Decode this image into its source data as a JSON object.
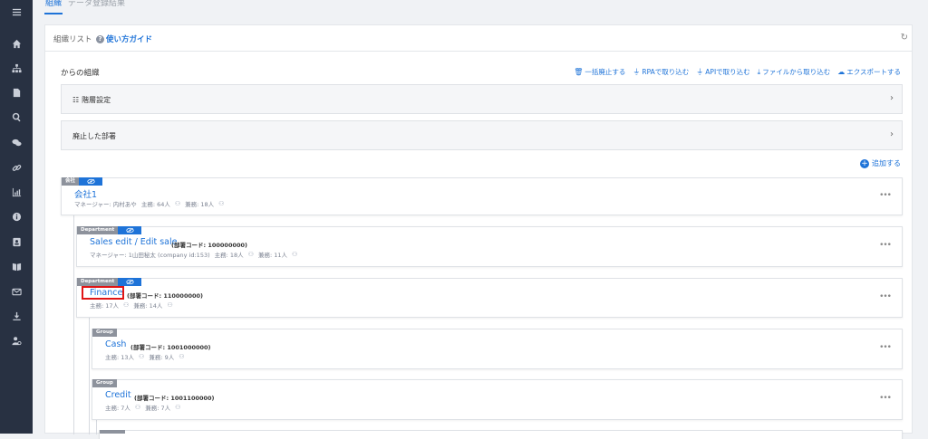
{
  "sidebar": {
    "icons": [
      "menu-icon",
      "home-icon",
      "org-chart-icon",
      "document-icon",
      "search-icon",
      "chat-icon",
      "link-icon",
      "chart-icon",
      "info-icon",
      "contact-card-icon",
      "book-icon",
      "mail-icon",
      "download-icon",
      "user-settings-icon"
    ]
  },
  "tabs": [
    {
      "label": "組織",
      "active": true
    },
    {
      "label": "データ登録結果",
      "active": false
    }
  ],
  "panel": {
    "title": "組織リスト",
    "guide_label": "使い方ガイド"
  },
  "section": {
    "title": "からの組織",
    "actions": [
      {
        "icon": "trash-icon",
        "label": "一括廃止する"
      },
      {
        "icon": "plug-icon",
        "label": "RPAで取り込む"
      },
      {
        "icon": "plug-icon",
        "label": "APIで取り込む"
      },
      {
        "icon": "download-icon",
        "label": "ファイルから取り込む"
      },
      {
        "icon": "cloud-upload-icon",
        "label": "エクスポートする"
      }
    ]
  },
  "collapsibles": [
    {
      "label": "階層設定"
    },
    {
      "label": "廃止した部署"
    }
  ],
  "add_label": "追加する",
  "cards": [
    {
      "type": "会社",
      "name": "会社1",
      "code": "",
      "manager": "マネージャー: 内村あや",
      "main": "主務: 64人",
      "sub": "兼務: 18人"
    },
    {
      "type": "Department",
      "name": "Sales edit / Edit sale",
      "code": "(部署コード: 100000000)",
      "manager": "マネージャー: 1山田秘太 (company id:153)",
      "main": "主務: 18人",
      "sub": "兼務: 11人"
    },
    {
      "type": "Department",
      "name": "Finance",
      "code": "(部署コード: 110000000)",
      "manager": "",
      "main": "主務: 17人",
      "sub": "兼務: 14人"
    },
    {
      "type": "Group",
      "name": "Cash",
      "code": "(部署コード: 1001000000)",
      "manager": "",
      "main": "主務: 13人",
      "sub": "兼務: 9人"
    },
    {
      "type": "Group",
      "name": "Credit",
      "code": "(部署コード: 1001100000)",
      "manager": "",
      "main": "主務: 7人",
      "sub": "兼務: 7人"
    }
  ],
  "colors": {
    "accent": "#1e73d8",
    "sidebar": "#283142",
    "highlight": "#e01515"
  }
}
